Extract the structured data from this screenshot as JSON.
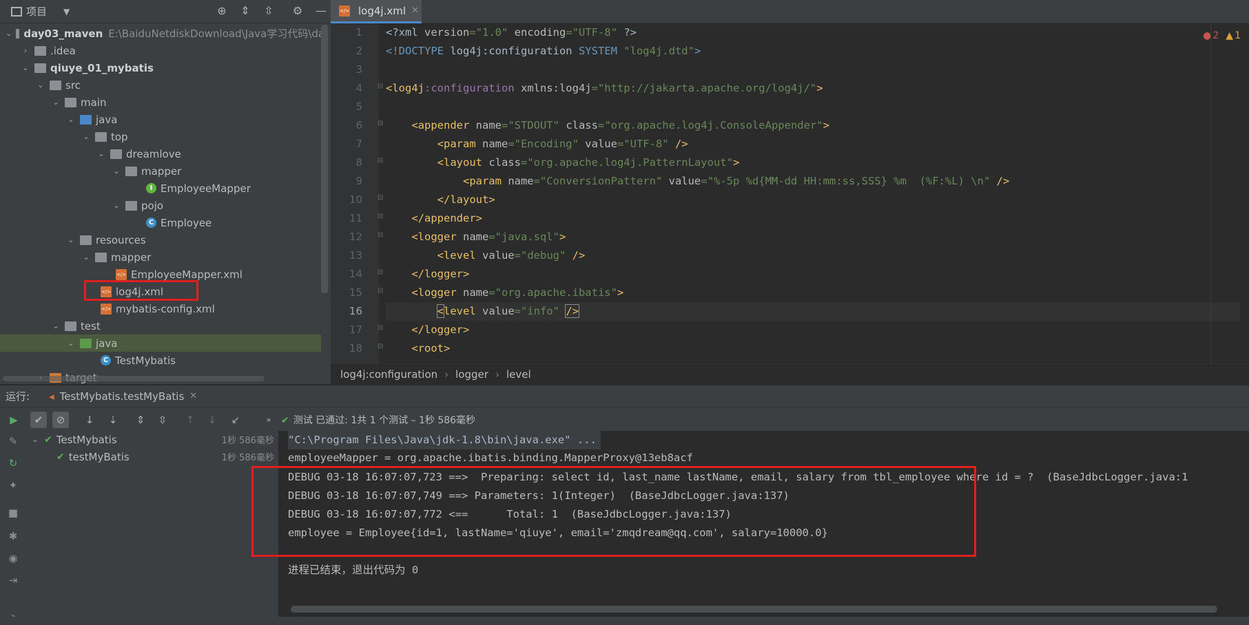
{
  "project": {
    "title": "项目",
    "tree": [
      {
        "label": "day03_maven",
        "path": "E:\\BaiduNetdiskDownload\\Java学习代码\\day",
        "bold": true
      },
      {
        "label": ".idea"
      },
      {
        "label": "qiuye_01_mybatis",
        "bold": true
      },
      {
        "label": "src"
      },
      {
        "label": "main"
      },
      {
        "label": "java"
      },
      {
        "label": "top"
      },
      {
        "label": "dreamlove"
      },
      {
        "label": "mapper"
      },
      {
        "label": "EmployeeMapper"
      },
      {
        "label": "pojo"
      },
      {
        "label": "Employee"
      },
      {
        "label": "resources"
      },
      {
        "label": "mapper"
      },
      {
        "label": "EmployeeMapper.xml"
      },
      {
        "label": "log4j.xml"
      },
      {
        "label": "mybatis-config.xml"
      },
      {
        "label": "test"
      },
      {
        "label": "java"
      },
      {
        "label": "TestMybatis"
      },
      {
        "label": "target"
      }
    ]
  },
  "editor": {
    "tab_label": "log4j.xml",
    "errors": "2",
    "warnings": "1",
    "line_numbers": [
      "1",
      "2",
      "3",
      "4",
      "5",
      "6",
      "7",
      "8",
      "9",
      "10",
      "11",
      "12",
      "13",
      "14",
      "15",
      "16",
      "17",
      "18"
    ],
    "breadcrumb": [
      "log4j:configuration",
      "logger",
      "level"
    ]
  },
  "run": {
    "label": "运行:",
    "tab_label": "TestMybatis.testMyBatis",
    "status": "测试 已通过: 1共 1 个测试 – 1秒 586毫秒",
    "tests": [
      {
        "name": "TestMybatis",
        "time": "1秒 586毫秒"
      },
      {
        "name": "testMyBatis",
        "time": "1秒 586毫秒"
      }
    ],
    "console": [
      "\"C:\\Program Files\\Java\\jdk-1.8\\bin\\java.exe\" ...",
      "employeeMapper = org.apache.ibatis.binding.MapperProxy@13eb8acf",
      "DEBUG 03-18 16:07:07,723 ==>  Preparing: select id, last_name lastName, email, salary from tbl_employee where id = ?  (BaseJdbcLogger.java:1",
      "DEBUG 03-18 16:07:07,749 ==> Parameters: 1(Integer)  (BaseJdbcLogger.java:137)",
      "DEBUG 03-18 16:07:07,772 <==      Total: 1  (BaseJdbcLogger.java:137)",
      "employee = Employee{id=1, lastName='qiuye', email='zmqdream@qq.com', salary=10000.0}",
      "",
      "进程已结束，退出代码为 0"
    ]
  },
  "colors": {
    "highlight_box": "#e0201e",
    "pass_green": "#5fad56"
  }
}
